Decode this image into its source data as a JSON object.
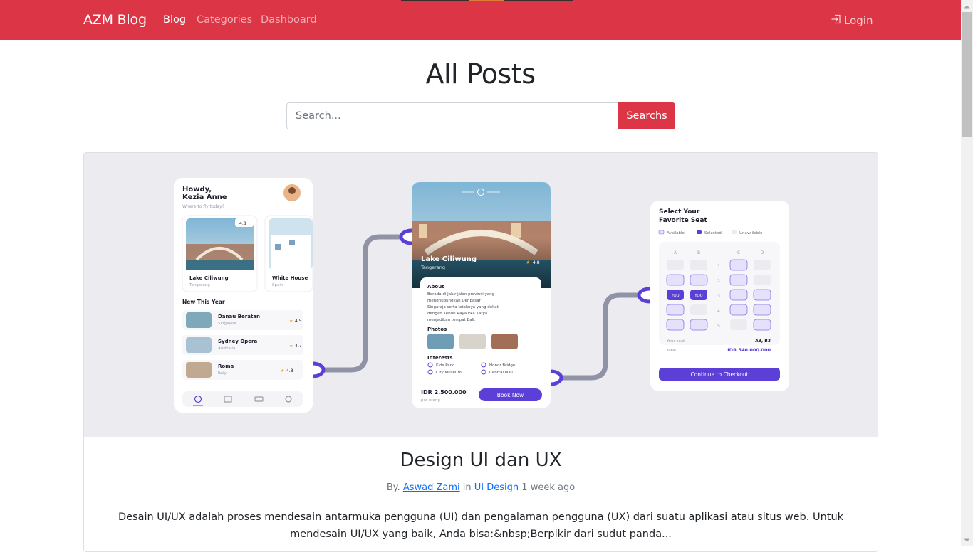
{
  "navbar": {
    "brand": "AZM Blog",
    "links": [
      {
        "label": "Blog",
        "active": true
      },
      {
        "label": "Categories",
        "active": false
      },
      {
        "label": "Dashboard",
        "active": false
      }
    ],
    "login_label": "Login",
    "color": "#dc3545"
  },
  "page": {
    "title": "All Posts"
  },
  "search": {
    "placeholder": "Search...",
    "button_label": "Searchs"
  },
  "post": {
    "title": "Design UI dan UX",
    "by_prefix": "By.",
    "author": "Aswad Zami",
    "in_word": "in",
    "category": "UI Design",
    "time_ago": "1 week ago",
    "excerpt": "Desain UI/UX adalah proses mendesain antarmuka pengguna (UI) dan pengalaman pengguna (UX) dari suatu aplikasi atau situs web. Untuk mendesain UI/UX yang baik, Anda bisa:&nbsp;Berpikir dari sudut panda...",
    "image": {
      "screen1": {
        "greeting": "Howdy,",
        "name": "Kezia Anne",
        "subtitle": "Where to fly today?",
        "cards": [
          {
            "title": "Lake Ciliwung",
            "location": "Tangerang",
            "rating": "4.8"
          },
          {
            "title": "White House",
            "location": "Spain"
          }
        ],
        "section_title": "New This Year",
        "list": [
          {
            "title": "Danau Beratan",
            "location": "Singajara",
            "rating": "4.5"
          },
          {
            "title": "Sydney Opera",
            "location": "Australia",
            "rating": "4.7"
          },
          {
            "title": "Roma",
            "location": "Italy",
            "rating": "4.8"
          }
        ]
      },
      "screen2": {
        "title": "Lake Ciliwung",
        "location": "Tangerang",
        "rating": "4.8",
        "about_title": "About",
        "about_lines": [
          "Berada di jalur jalan provinsi yang",
          "menghubungkan Denpasar",
          "Singaraja serta letaknya yang dekat",
          "dengan Kebun Raya Eka Karya",
          "menjadikan tempat Bali."
        ],
        "photos_title": "Photos",
        "interests_title": "Interests",
        "interests": [
          "Kids Park",
          "Honor Bridge",
          "City Museum",
          "Central Mall"
        ],
        "price": "IDR 2.500.000",
        "price_sub": "per orang",
        "book_label": "Book Now"
      },
      "screen3": {
        "title_line1": "Select Your",
        "title_line2": "Favorite Seat",
        "legend": [
          "Available",
          "Selected",
          "Unavailable"
        ],
        "columns": [
          "A",
          "B",
          "C",
          "D"
        ],
        "rows": [
          "1",
          "2",
          "3",
          "4",
          "5"
        ],
        "you_label": "YOU",
        "your_seat_label": "Your seat",
        "your_seat_value": "A3, B3",
        "total_label": "Total",
        "total_value": "IDR 540.000.000",
        "checkout_label": "Continue to Checkout"
      },
      "accent": "#5b3fd6"
    }
  }
}
